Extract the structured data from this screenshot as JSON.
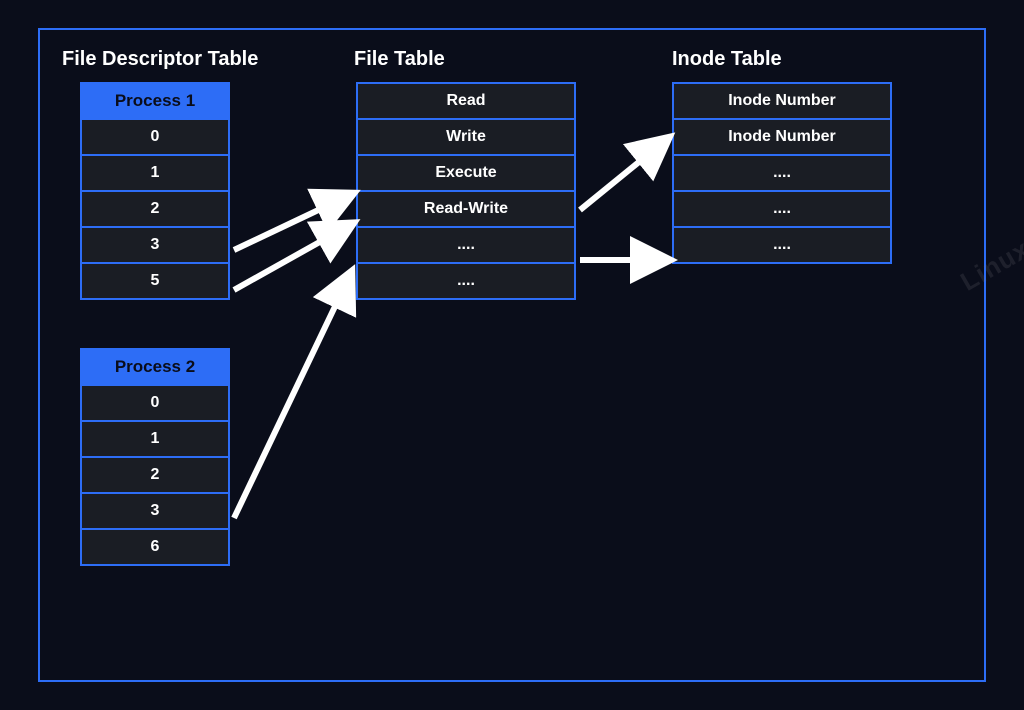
{
  "titles": {
    "fd_table": "File Descriptor Table",
    "file_table": "File Table",
    "inode_table": "Inode Table"
  },
  "process1": {
    "header": "Process 1",
    "rows": [
      "0",
      "1",
      "2",
      "3",
      "5"
    ]
  },
  "process2": {
    "header": "Process 2",
    "rows": [
      "0",
      "1",
      "2",
      "3",
      "6"
    ]
  },
  "file_table": {
    "rows": [
      "Read",
      "Write",
      "Execute",
      "Read-Write",
      "....",
      "...."
    ]
  },
  "inode_table": {
    "rows": [
      "Inode Number",
      "Inode Number",
      "....",
      "....",
      "...."
    ]
  },
  "watermark": "Linux"
}
